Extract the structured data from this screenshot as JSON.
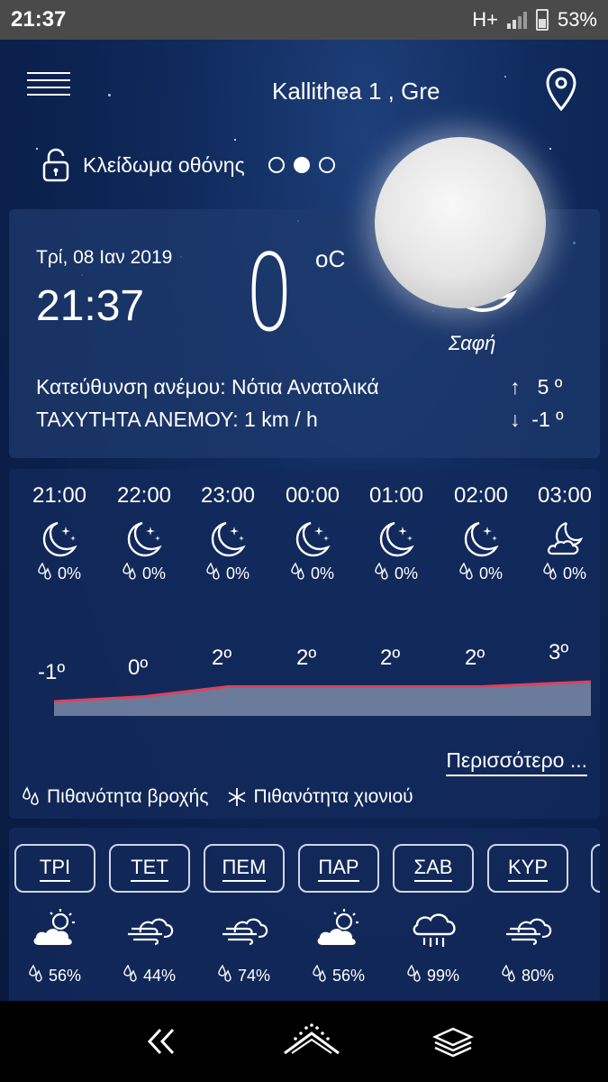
{
  "status": {
    "time": "21:37",
    "network": "H+",
    "battery": "53%"
  },
  "header": {
    "location": "Kallithea 1 , Gre"
  },
  "lock": {
    "label": "Κλείδωμα οθόνης"
  },
  "current": {
    "date": "Τρί, 08 Ιαν 2019",
    "clock": "21:37",
    "temp": "0",
    "unit": "oC",
    "condition": "Σαφή",
    "wind_direction": "Κατεύθυνση ανέμου: Νότια Ανατολικά",
    "wind_speed": "ΤΑΧΥΤΗΤΑ ΑΝΕΜΟΥ: 1 km / h",
    "max": "5 º",
    "min": "-1 º",
    "arrow_up": "↑",
    "arrow_down": "↓"
  },
  "hourly": [
    {
      "time": "21:00",
      "icon": "moon-stars-icon",
      "precip": "0%",
      "temp": "-1º",
      "value": -1
    },
    {
      "time": "22:00",
      "icon": "moon-stars-icon",
      "precip": "0%",
      "temp": "0º",
      "value": 0
    },
    {
      "time": "23:00",
      "icon": "moon-stars-icon",
      "precip": "0%",
      "temp": "2º",
      "value": 2
    },
    {
      "time": "00:00",
      "icon": "moon-stars-icon",
      "precip": "0%",
      "temp": "2º",
      "value": 2
    },
    {
      "time": "01:00",
      "icon": "moon-stars-icon",
      "precip": "0%",
      "temp": "2º",
      "value": 2
    },
    {
      "time": "02:00",
      "icon": "moon-stars-icon",
      "precip": "0%",
      "temp": "2º",
      "value": 2
    },
    {
      "time": "03:00",
      "icon": "moon-cloud-icon",
      "precip": "0%",
      "temp": "3º",
      "value": 3
    }
  ],
  "more_label": "Περισσότερο ...",
  "legend": {
    "rain": "Πιθανότητα βροχής",
    "snow": "Πιθανότητα χιονιού"
  },
  "daily": [
    {
      "day": "ΤΡΙ",
      "icon": "sun-cloud-icon",
      "precip": "56%"
    },
    {
      "day": "ΤΕΤ",
      "icon": "wind-cloud-icon",
      "precip": "44%"
    },
    {
      "day": "ΠΕΜ",
      "icon": "wind-cloud-icon",
      "precip": "74%"
    },
    {
      "day": "ΠΑΡ",
      "icon": "sun-cloud-icon",
      "precip": "56%"
    },
    {
      "day": "ΣΑΒ",
      "icon": "rain-cloud-icon",
      "precip": "99%"
    },
    {
      "day": "ΚΥΡ",
      "icon": "wind-cloud-icon",
      "precip": "80%"
    }
  ],
  "colors": {
    "line": "#e0405a",
    "fill": "#7a8aa8",
    "card": "#12305f"
  }
}
